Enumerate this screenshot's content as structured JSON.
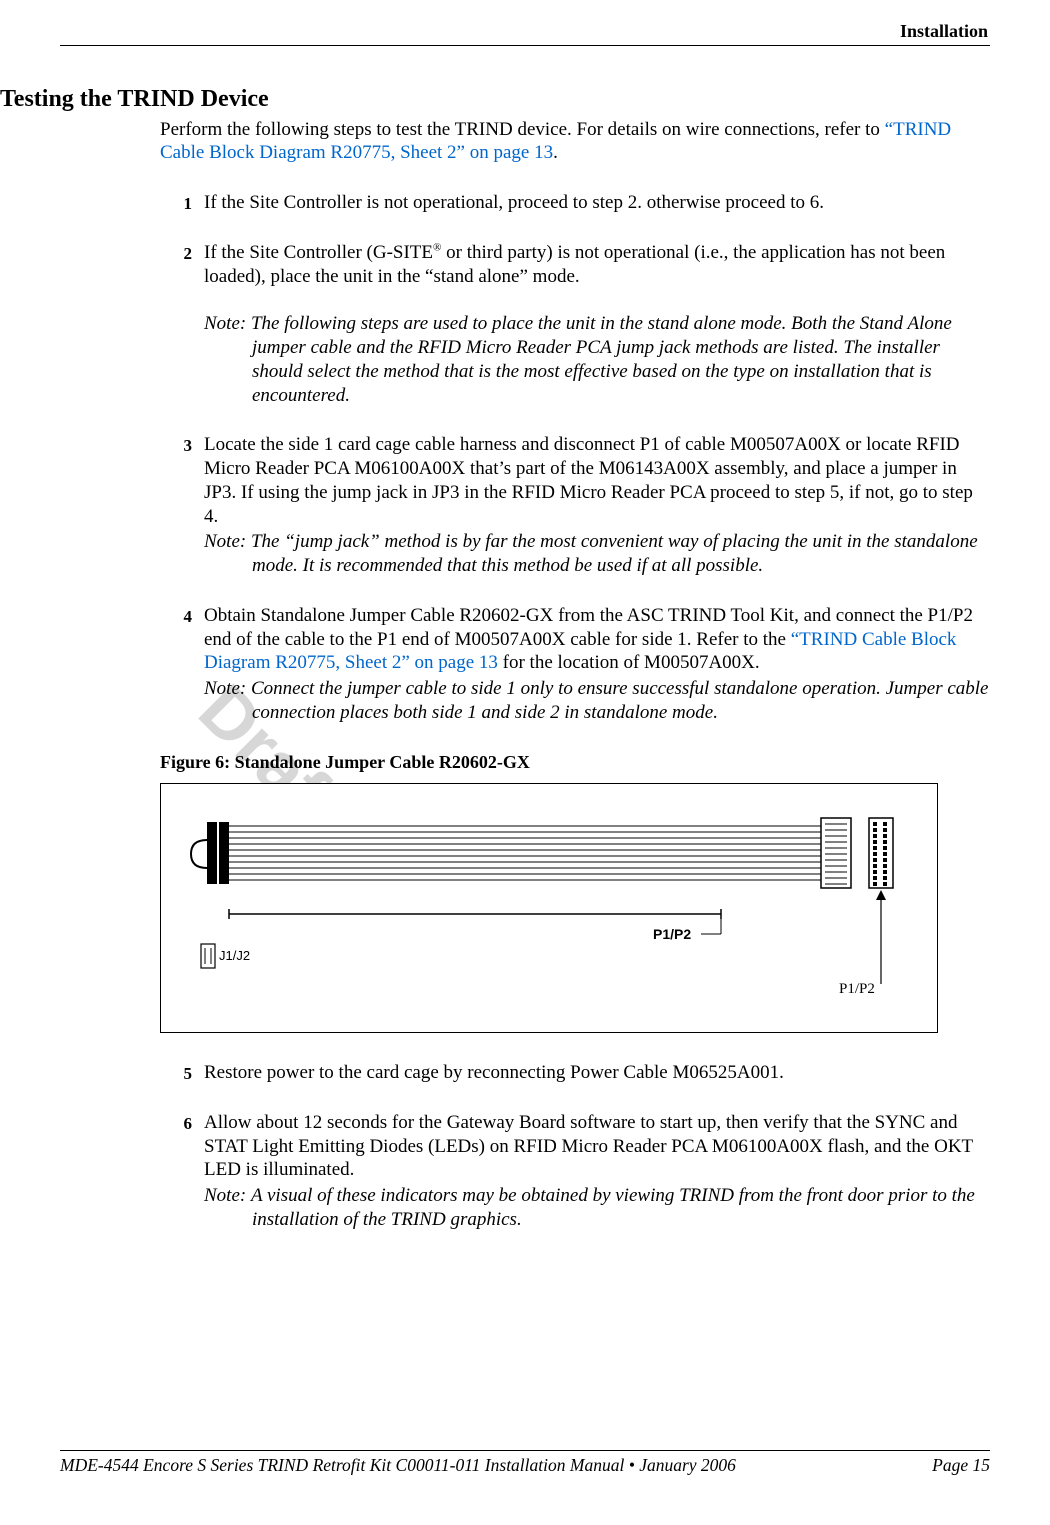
{
  "header": {
    "section": "Installation"
  },
  "watermark": "Draft",
  "title": "Testing the TRIND Device",
  "intro_pre": "Perform the following steps to test the TRIND device. For details on wire connections, refer to ",
  "intro_link": "“TRIND Cable Block Diagram R20775, Sheet 2” on page 13",
  "intro_post": ".",
  "steps": [
    {
      "num": "1",
      "text": "If the Site Controller is not operational, proceed to step 2. otherwise proceed to 6."
    },
    {
      "num": "2",
      "text_pre": "If the Site Controller (G-SITE",
      "sup": "®",
      "text_post": " or third party) is not operational (i.e., the application has not been loaded), place the unit in the “stand alone” mode.",
      "note": "The following steps are used to place the unit in the stand alone mode. Both the Stand Alone jumper cable and the RFID Micro Reader PCA jump jack methods are listed. The installer should select the method that is the most effective based on the type on installation that is encountered."
    },
    {
      "num": "3",
      "text": "Locate the side 1 card cage cable harness and disconnect P1 of cable M00507A00X or locate RFID Micro Reader PCA M06100A00X  that’s part of the M06143A00X assembly, and place a jumper in JP3. If using the jump jack in JP3 in the RFID Micro Reader PCA proceed to step 5, if not, go to step 4.",
      "note": "The “jump jack” method is by far the most convenient way of placing the unit in the standalone mode. It is recommended that this method be used if at all possible."
    },
    {
      "num": "4",
      "text_pre": "Obtain Standalone Jumper Cable R20602-GX from the ASC TRIND Tool Kit, and connect the P1/P2 end of the cable to the P1 end of M00507A00X cable for side 1. Refer to the ",
      "link": "“TRIND Cable Block Diagram R20775, Sheet 2” on page 13",
      "text_post": " for the location of M00507A00X.",
      "note": "Connect the jumper cable to side 1 only to ensure successful standalone operation. Jumper cable connection places both side 1 and side 2 in standalone mode."
    },
    {
      "num": "5",
      "text": "Restore power to the card cage by reconnecting Power Cable M06525A001."
    },
    {
      "num": "6",
      "text": "Allow about 12 seconds for the Gateway Board software to start up, then verify that the SYNC and STAT Light Emitting Diodes (LEDs) on RFID Micro Reader PCA M06100A00X  flash, and the OKT LED  is illuminated.",
      "note": "A visual of these indicators may be obtained by viewing TRIND from the front door prior to the installation of the TRIND graphics."
    }
  ],
  "figure": {
    "caption": "Figure 6: Standalone Jumper Cable R20602-GX",
    "label_inside": "P1/P2",
    "label_j": "J1/J2",
    "annotation": "P1/P2"
  },
  "note_label": "Note:",
  "footer": {
    "doc": "MDE-4544 Encore S Series TRIND Retrofit Kit C00011-011 Installation Manual • January 2006",
    "page": "Page 15"
  }
}
